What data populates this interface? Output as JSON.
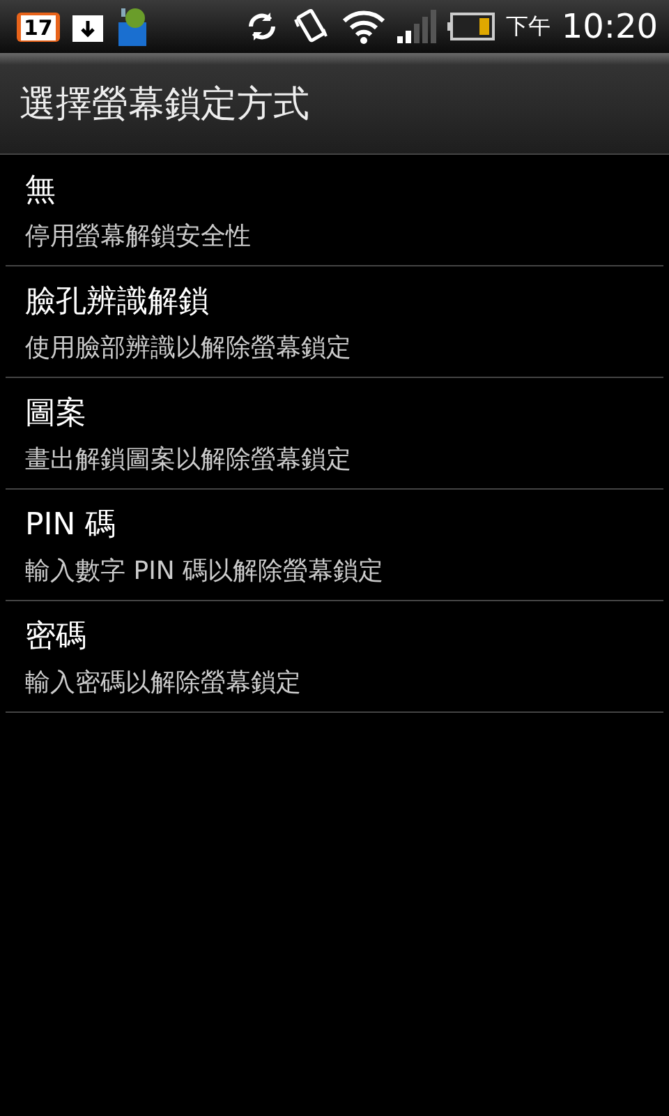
{
  "status_bar": {
    "calendar_date": "17",
    "period": "下午",
    "time": "10:20"
  },
  "title": "選擇螢幕鎖定方式",
  "options": [
    {
      "title": "無",
      "summary": "停用螢幕解鎖安全性"
    },
    {
      "title": "臉孔辨識解鎖",
      "summary": "使用臉部辨識以解除螢幕鎖定"
    },
    {
      "title": "圖案",
      "summary": "畫出解鎖圖案以解除螢幕鎖定"
    },
    {
      "title": "PIN 碼",
      "summary": "輸入數字 PIN 碼以解除螢幕鎖定"
    },
    {
      "title": "密碼",
      "summary": "輸入密碼以解除螢幕鎖定"
    }
  ]
}
